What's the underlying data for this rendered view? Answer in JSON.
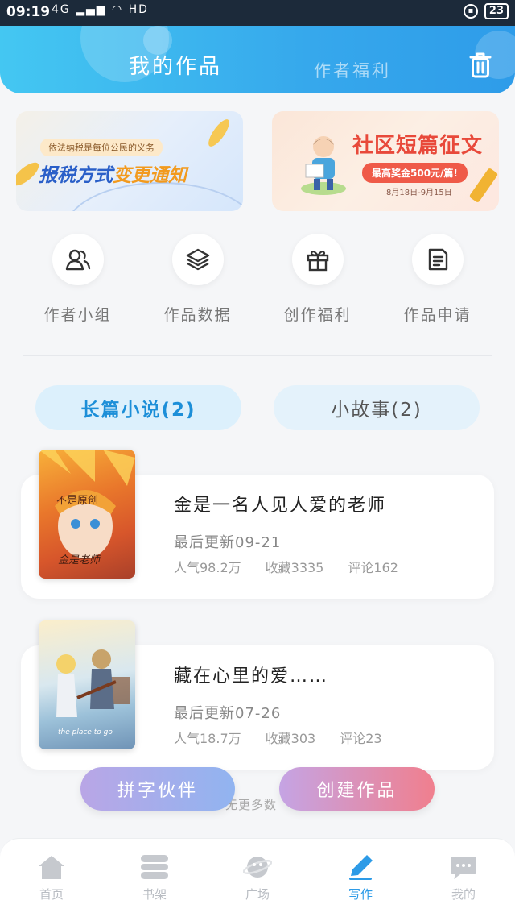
{
  "status_bar": {
    "time": "09:19",
    "network": "4G",
    "hd": "HD",
    "battery": "23"
  },
  "header": {
    "tab_active": "我的作品",
    "tab_inactive": "作者福利",
    "trash_icon": "trash-icon"
  },
  "banners": {
    "left": {
      "tag": "依法纳税是每位公民的义务",
      "headline_a": "报税方式",
      "headline_b": "变更通知"
    },
    "right": {
      "title": "社区短篇征文",
      "prize": "最高奖金500元/篇!",
      "dates": "8月18日-9月15日"
    }
  },
  "quick_entries": [
    {
      "label": "作者小组",
      "icon": "people-icon"
    },
    {
      "label": "作品数据",
      "icon": "layers-icon"
    },
    {
      "label": "创作福利",
      "icon": "gift-icon"
    },
    {
      "label": "作品申请",
      "icon": "document-icon"
    }
  ],
  "segments": {
    "long": "长篇小说(2)",
    "short": "小故事(2)"
  },
  "works": [
    {
      "title": "金是一名人见人爱的老师",
      "updated": "最后更新09-21",
      "popularity": "人气98.2万",
      "favorites": "收藏3335",
      "comments": "评论162",
      "cover_text_top": "不是原创",
      "cover_text_bottom": "金是老师"
    },
    {
      "title": "藏在心里的爱……",
      "updated": "最后更新07-26",
      "popularity": "人气18.7万",
      "favorites": "收藏303",
      "comments": "评论23",
      "cover_text_bottom": "the place to go"
    }
  ],
  "footer_hint": "无更多数",
  "actions": {
    "partner": "拼字伙伴",
    "create": "创建作品"
  },
  "bottom_nav": [
    {
      "label": "首页",
      "icon": "home-icon"
    },
    {
      "label": "书架",
      "icon": "bookshelf-icon"
    },
    {
      "label": "广场",
      "icon": "planet-icon"
    },
    {
      "label": "写作",
      "icon": "pen-icon",
      "active": true
    },
    {
      "label": "我的",
      "icon": "chat-icon"
    }
  ],
  "colors": {
    "accent": "#2d9be7",
    "header_start": "#44c7f2",
    "header_end": "#2e9ce9",
    "create_gradient_end": "#f07f8e"
  }
}
